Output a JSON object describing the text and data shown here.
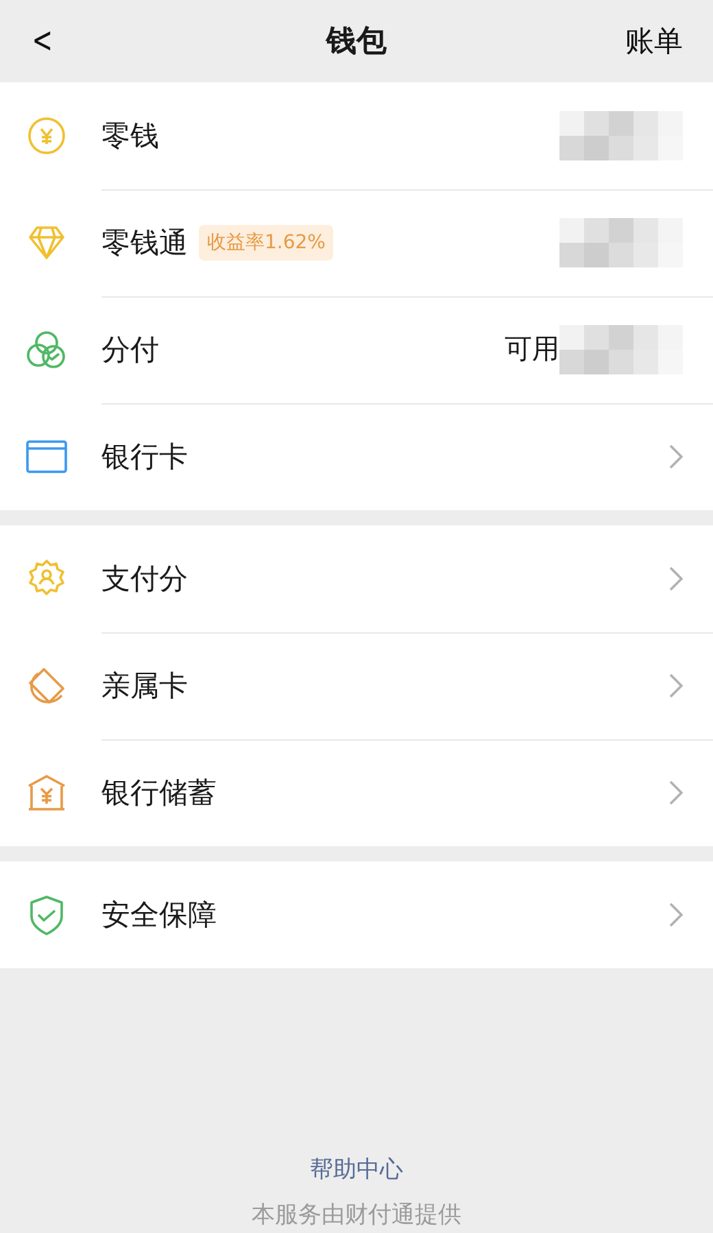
{
  "nav": {
    "back": "<",
    "title": "钱包",
    "action": "账单"
  },
  "sections": [
    {
      "items": [
        {
          "label": "零钱",
          "kind": "redacted"
        },
        {
          "label": "零钱通",
          "badge": "收益率1.62%",
          "kind": "redacted"
        },
        {
          "label": "分付",
          "value_prefix": "可用",
          "kind": "redacted"
        },
        {
          "label": "银行卡",
          "kind": "chevron"
        }
      ]
    },
    {
      "items": [
        {
          "label": "支付分",
          "kind": "chevron"
        },
        {
          "label": "亲属卡",
          "kind": "chevron"
        },
        {
          "label": "银行储蓄",
          "kind": "chevron"
        }
      ]
    },
    {
      "items": [
        {
          "label": "安全保障",
          "kind": "chevron"
        }
      ]
    }
  ],
  "footer": {
    "link": "帮助中心",
    "note": "本服务由财付通提供"
  }
}
